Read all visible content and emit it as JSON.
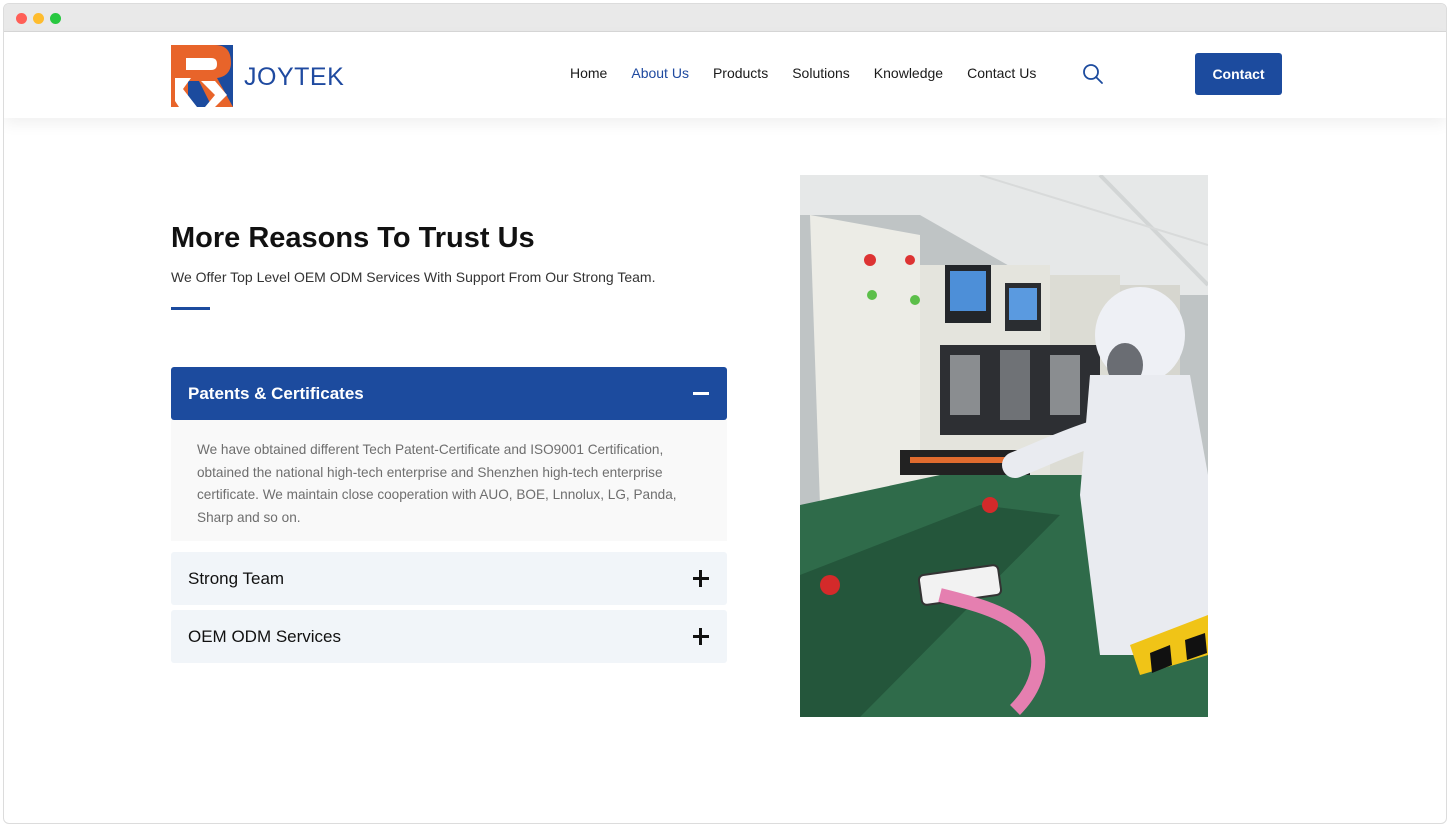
{
  "header": {
    "logo_text": "JOYTEK",
    "nav": [
      {
        "label": "Home",
        "active": false
      },
      {
        "label": "About Us",
        "active": true
      },
      {
        "label": "Products",
        "active": false
      },
      {
        "label": "Solutions",
        "active": false
      },
      {
        "label": "Knowledge",
        "active": false
      },
      {
        "label": "Contact Us",
        "active": false
      }
    ],
    "search_icon": "search-icon",
    "contact_button": "Contact"
  },
  "section": {
    "title": "More Reasons To Trust Us",
    "subtitle": "We Offer Top Level OEM ODM Services With Support From Our Strong Team."
  },
  "accordion": [
    {
      "title": "Patents & Certificates",
      "expanded": true,
      "icon": "minus-icon",
      "body": "We have obtained different Tech Patent-Certificate and ISO9001 Certification, obtained the national high-tech enterprise and Shenzhen high-tech enterprise certificate. We maintain close cooperation with AUO, BOE, Lnnolux, LG, Panda, Sharp and so on."
    },
    {
      "title": "Strong Team",
      "expanded": false,
      "icon": "plus-icon"
    },
    {
      "title": "OEM ODM Services",
      "expanded": false,
      "icon": "plus-icon"
    }
  ],
  "colors": {
    "brand_blue": "#1c4b9e",
    "logo_orange": "#e8642a",
    "closed_panel": "#f1f5f9"
  }
}
